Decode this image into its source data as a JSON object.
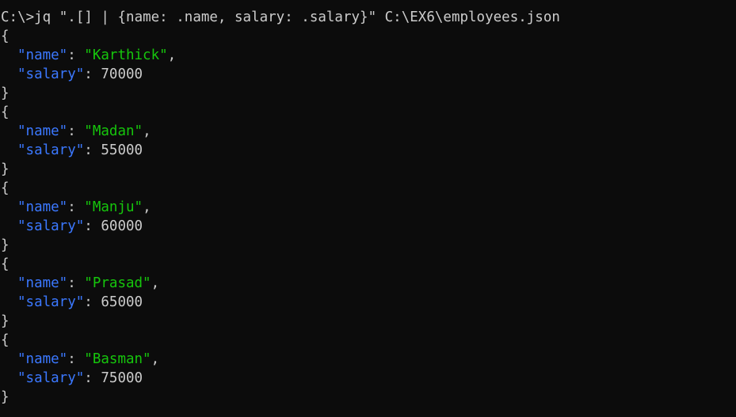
{
  "terminal": {
    "command_line": "C:\\>jq \".[] | {name: .name, salary: .salary}\" C:\\EX6\\employees.json",
    "open_brace": "{",
    "close_brace": "}",
    "key_name": "\"name\"",
    "key_salary": "\"salary\"",
    "colon": ": ",
    "comma": ",",
    "records": [
      {
        "name": "\"Karthick\"",
        "salary": "70000"
      },
      {
        "name": "\"Madan\"",
        "salary": "55000"
      },
      {
        "name": "\"Manju\"",
        "salary": "60000"
      },
      {
        "name": "\"Prasad\"",
        "salary": "65000"
      },
      {
        "name": "\"Basman\"",
        "salary": "75000"
      }
    ],
    "colors": {
      "background": "#0c0c0c",
      "text": "#cccccc",
      "json_key": "#3b78ff",
      "json_string": "#16c60c"
    }
  }
}
